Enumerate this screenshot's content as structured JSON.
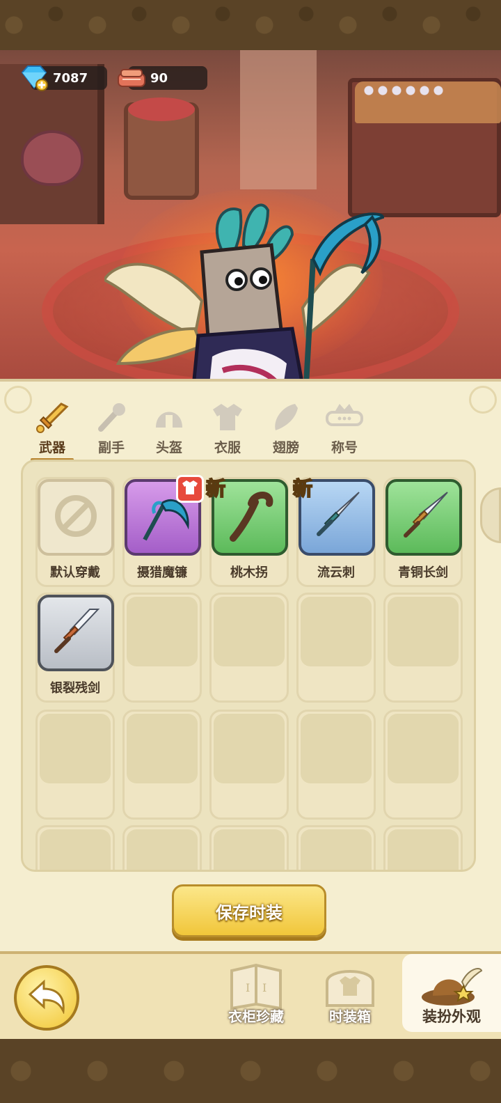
{
  "currency": {
    "gems": "7087",
    "cloth": "90"
  },
  "tabs": [
    {
      "label": "武器",
      "icon": "sword-icon",
      "active": true
    },
    {
      "label": "副手",
      "icon": "offhand-icon"
    },
    {
      "label": "头盔",
      "icon": "helmet-icon"
    },
    {
      "label": "衣服",
      "icon": "armor-icon"
    },
    {
      "label": "翅膀",
      "icon": "wings-icon"
    },
    {
      "label": "称号",
      "icon": "title-badge-icon"
    }
  ],
  "items": [
    {
      "name": "默认穿戴",
      "rarity": "default",
      "icon": "no-entry-icon"
    },
    {
      "name": "摄猎魔镰",
      "rarity": "purple",
      "icon": "scythe-icon",
      "equipped": true
    },
    {
      "name": "桃木拐",
      "rarity": "green",
      "icon": "staff-icon",
      "tag": "新"
    },
    {
      "name": "流云刺",
      "rarity": "blue",
      "icon": "dagger-icon",
      "tag": "新"
    },
    {
      "name": "青铜长剑",
      "rarity": "green",
      "icon": "longsword-icon"
    },
    {
      "name": "银裂残剑",
      "rarity": "gray",
      "icon": "broken-sword-icon"
    }
  ],
  "save_button": "保存时装",
  "bottom_nav": [
    {
      "label": "衣柜珍藏",
      "icon": "wardrobe-book-icon"
    },
    {
      "label": "时装箱",
      "icon": "fashion-chest-icon"
    },
    {
      "label": "装扮外观",
      "icon": "hat-icon",
      "active": true
    }
  ],
  "colors": {
    "panel": "#f5eed0",
    "accent": "#f1c63a",
    "rarity_purple": "#a45ec8",
    "rarity_green": "#5cba5a",
    "rarity_blue": "#7aa6d8",
    "rarity_gray": "#b9bec6"
  }
}
